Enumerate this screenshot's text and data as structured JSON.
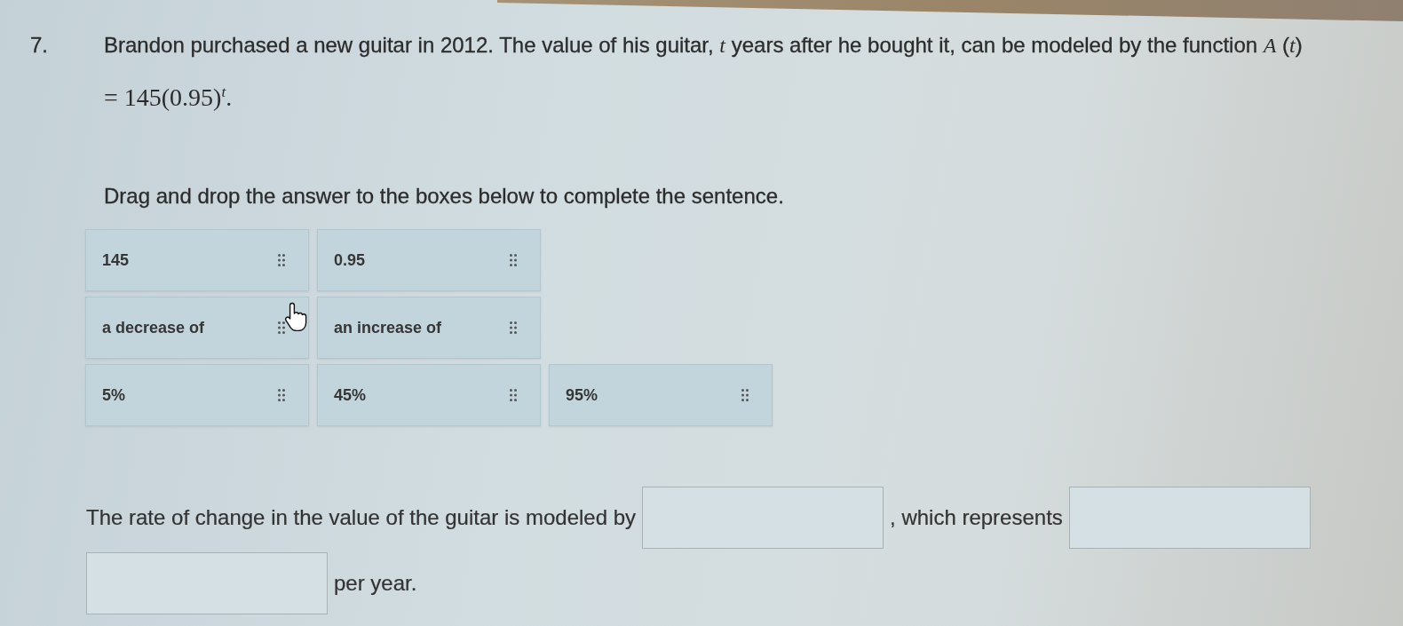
{
  "question": {
    "number": "7.",
    "text": "Brandon purchased a new guitar in 2012. The value of his guitar, *t* years after he bought it, can be modeled by the function *A* (*t*)",
    "formula": "= 145(0.95)$^{t}$."
  },
  "instruction": "Drag and drop the answer to the boxes below to complete the sentence.",
  "tile_rows": [
    {
      "tiles": [
        {
          "label": "145"
        },
        {
          "label": "0.95"
        }
      ]
    },
    {
      "tiles": [
        {
          "label": "a decrease of"
        },
        {
          "label": "an increase of"
        }
      ]
    },
    {
      "tiles": [
        {
          "label": "5%"
        },
        {
          "label": "45%"
        },
        {
          "label": "95%"
        }
      ]
    }
  ],
  "sentence": [
    {
      "kind": "text",
      "text": "The rate of change in the value of the guitar is modeled by"
    },
    {
      "kind": "blank"
    },
    {
      "kind": "text",
      "text": ", which represents"
    },
    {
      "kind": "blank"
    },
    {
      "kind": "blank"
    },
    {
      "kind": "text",
      "text": "per year."
    }
  ]
}
